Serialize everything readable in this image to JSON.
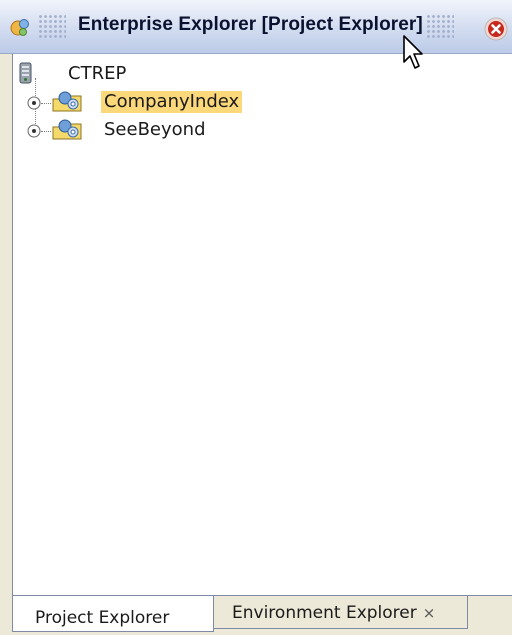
{
  "window": {
    "title": "Enterprise Explorer [Project Explorer]"
  },
  "tree": {
    "root": {
      "label": "CTREP",
      "icon": "repository-icon"
    },
    "items": [
      {
        "label": "CompanyIndex",
        "icon": "project-icon",
        "expander": "expand-icon",
        "selected": true
      },
      {
        "label": "SeeBeyond",
        "icon": "project-icon",
        "expander": "expand-icon",
        "selected": false
      }
    ]
  },
  "tabs": [
    {
      "label": "Project Explorer",
      "active": true
    },
    {
      "label": "Environment Explorer",
      "active": false,
      "close": "×"
    }
  ],
  "colors": {
    "selection": "#fbd87a",
    "titlebar": "#d2dcf0",
    "close_button": "#c62a1f"
  }
}
